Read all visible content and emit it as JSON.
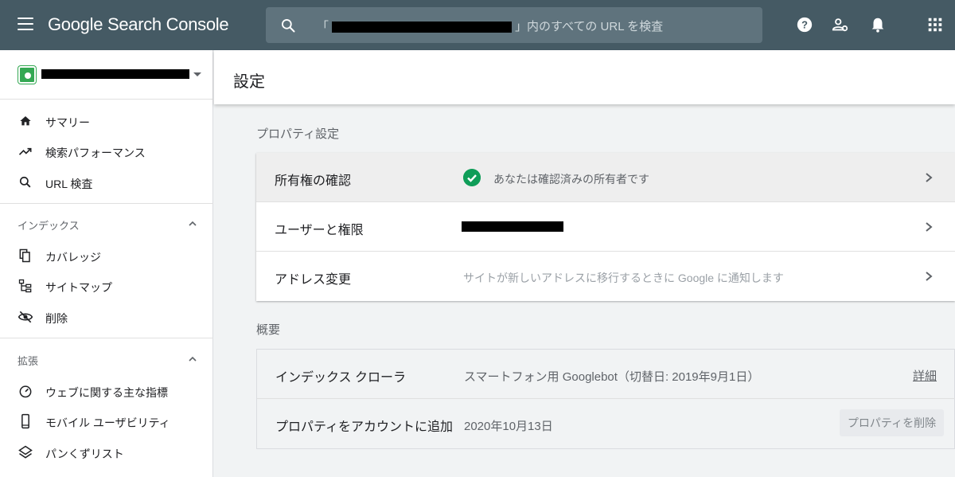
{
  "header": {
    "app_name": "Google Search Console",
    "search_suffix": "」内のすべての URL を検査",
    "search_prefix": "「",
    "icons": [
      "menu-icon",
      "search-icon",
      "help-icon",
      "user-settings-icon",
      "notifications-icon",
      "apps-grid-icon"
    ]
  },
  "sidebar": {
    "property_icon": "site-favicon",
    "main_items": [
      {
        "label": "サマリー",
        "icon": "home-icon"
      },
      {
        "label": "検索パフォーマンス",
        "icon": "trending-up-icon"
      },
      {
        "label": "URL 検査",
        "icon": "search-icon"
      }
    ],
    "sections": [
      {
        "title": "インデックス",
        "items": [
          {
            "label": "カバレッジ",
            "icon": "copy-icon"
          },
          {
            "label": "サイトマップ",
            "icon": "sitemap-icon"
          },
          {
            "label": "削除",
            "icon": "eye-off-icon"
          }
        ]
      },
      {
        "title": "拡張",
        "items": [
          {
            "label": "ウェブに関する主な指標",
            "icon": "gauge-icon"
          },
          {
            "label": "モバイル ユーザビリティ",
            "icon": "smartphone-icon"
          },
          {
            "label": "パンくずリスト",
            "icon": "layers-icon"
          }
        ]
      }
    ]
  },
  "page": {
    "title": "設定",
    "property_settings": {
      "label": "プロパティ設定",
      "rows": [
        {
          "label": "所有権の確認",
          "value": "あなたは確認済みの所有者です"
        },
        {
          "label": "ユーザーと権限",
          "value": ""
        },
        {
          "label": "アドレス変更",
          "value": "サイトが新しいアドレスに移行するときに Google に通知します"
        }
      ]
    },
    "overview": {
      "label": "概要",
      "rows": [
        {
          "label": "インデックス クローラ",
          "value": "スマートフォン用 Googlebot（切替日: 2019年9月1日）",
          "action": "詳細"
        },
        {
          "label": "プロパティをアカウントに追加",
          "value": "2020年10月13日",
          "action": "プロパティを削除"
        }
      ]
    }
  },
  "colors": {
    "topbar": "#455a64",
    "search_bg": "#5f737d",
    "verified_green": "#0f9d58",
    "row_highlight": "#eeeeee"
  }
}
